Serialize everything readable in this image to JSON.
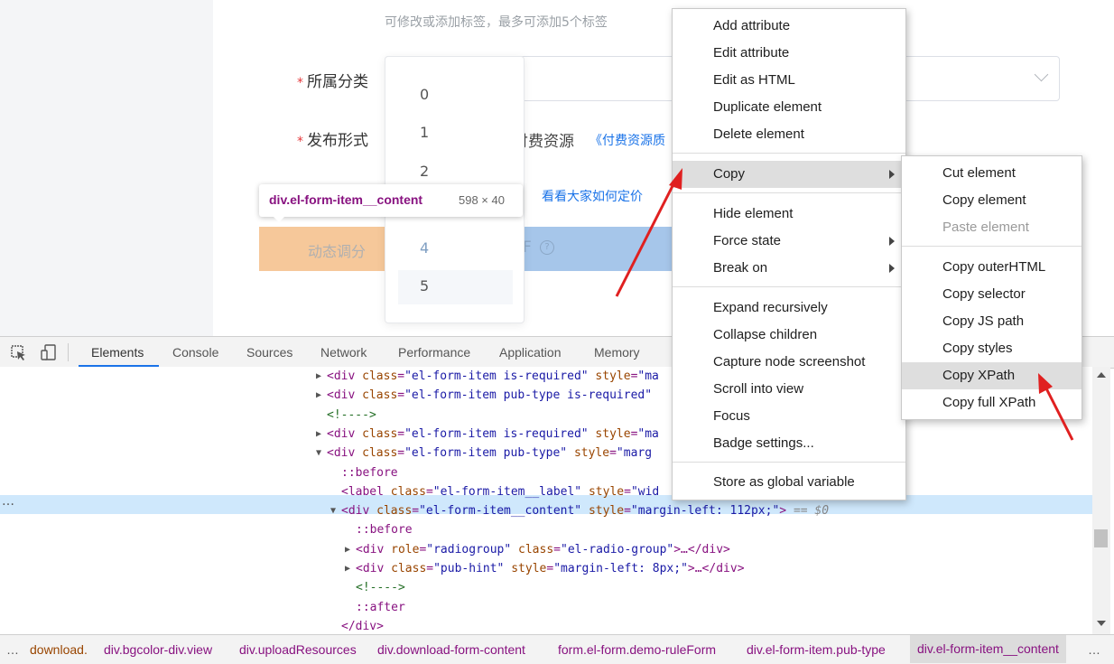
{
  "page": {
    "tag_hint": "可修改或添加标签，最多可添加5个标签",
    "category_label": "所属分类",
    "publish_label": "发布形式",
    "publish_value_partial": "付费资源",
    "paid_quality_link": "《付费资源质",
    "price_link": "看看大家如何定价",
    "dynamic_label": "动态调分",
    "dynamic_suffix": "F",
    "required_mark": "*",
    "dropdown_options": [
      "0",
      "1",
      "2",
      "4",
      "5"
    ],
    "tooltip": {
      "selector": "div.el-form-item__content",
      "size": "598 × 40"
    }
  },
  "devtools": {
    "tabs": [
      "Elements",
      "Console",
      "Sources",
      "Network",
      "Performance",
      "Application",
      "Memory"
    ],
    "code_lines": [
      {
        "indent": 350,
        "arrow": "▶",
        "parts": [
          [
            "tag",
            "<div "
          ],
          [
            "attr",
            "class"
          ],
          [
            "tag",
            "="
          ],
          [
            "val",
            "\"el-form-item is-required\""
          ],
          [
            "attr",
            " style"
          ],
          [
            "tag",
            "="
          ],
          [
            "val",
            "\"ma"
          ]
        ]
      },
      {
        "indent": 350,
        "arrow": "▶",
        "parts": [
          [
            "tag",
            "<div "
          ],
          [
            "attr",
            "class"
          ],
          [
            "tag",
            "="
          ],
          [
            "val",
            "\"el-form-item pub-type is-required\""
          ]
        ]
      },
      {
        "indent": 362,
        "arrow": "",
        "parts": [
          [
            "cmt",
            "<!---->"
          ]
        ]
      },
      {
        "indent": 350,
        "arrow": "▶",
        "parts": [
          [
            "tag",
            "<div "
          ],
          [
            "attr",
            "class"
          ],
          [
            "tag",
            "="
          ],
          [
            "val",
            "\"el-form-item is-required\""
          ],
          [
            "attr",
            " style"
          ],
          [
            "tag",
            "="
          ],
          [
            "val",
            "\"ma"
          ]
        ]
      },
      {
        "indent": 350,
        "arrow": "▼",
        "parts": [
          [
            "tag",
            "<div "
          ],
          [
            "attr",
            "class"
          ],
          [
            "tag",
            "="
          ],
          [
            "val",
            "\"el-form-item pub-type\""
          ],
          [
            "attr",
            " style"
          ],
          [
            "tag",
            "="
          ],
          [
            "val",
            "\"marg"
          ]
        ]
      },
      {
        "indent": 378,
        "arrow": "",
        "parts": [
          [
            "pseudo",
            "::before"
          ]
        ]
      },
      {
        "indent": 378,
        "arrow": "",
        "parts": [
          [
            "tag",
            "<label "
          ],
          [
            "attr",
            "class"
          ],
          [
            "tag",
            "="
          ],
          [
            "val",
            "\"el-form-item__label\""
          ],
          [
            "attr",
            " style"
          ],
          [
            "tag",
            "="
          ],
          [
            "val",
            "\"wid"
          ]
        ]
      },
      {
        "indent": 366,
        "arrow": "▼",
        "parts": [
          [
            "tag",
            "<div "
          ],
          [
            "attr",
            "class"
          ],
          [
            "tag",
            "="
          ],
          [
            "val",
            "\"el-form-item__content\""
          ],
          [
            "attr",
            " style"
          ],
          [
            "tag",
            "="
          ],
          [
            "val",
            "\"margin-left: 112px;\""
          ],
          [
            "tag",
            ">"
          ],
          [
            "ghost",
            " == $0"
          ]
        ]
      },
      {
        "indent": 394,
        "arrow": "",
        "parts": [
          [
            "pseudo",
            "::before"
          ]
        ]
      },
      {
        "indent": 382,
        "arrow": "▶",
        "parts": [
          [
            "tag",
            "<div "
          ],
          [
            "attr",
            "role"
          ],
          [
            "tag",
            "="
          ],
          [
            "val",
            "\"radiogroup\""
          ],
          [
            "attr",
            " class"
          ],
          [
            "tag",
            "="
          ],
          [
            "val",
            "\"el-radio-group\""
          ],
          [
            "tag",
            ">…</div>"
          ]
        ]
      },
      {
        "indent": 382,
        "arrow": "▶",
        "parts": [
          [
            "tag",
            "<div "
          ],
          [
            "attr",
            "class"
          ],
          [
            "tag",
            "="
          ],
          [
            "val",
            "\"pub-hint\""
          ],
          [
            "attr",
            " style"
          ],
          [
            "tag",
            "="
          ],
          [
            "val",
            "\"margin-left: 8px;\""
          ],
          [
            "tag",
            ">…</div>"
          ]
        ]
      },
      {
        "indent": 394,
        "arrow": "",
        "parts": [
          [
            "cmt",
            "<!---->"
          ]
        ]
      },
      {
        "indent": 394,
        "arrow": "",
        "parts": [
          [
            "pseudo",
            "::after"
          ]
        ]
      },
      {
        "indent": 378,
        "arrow": "",
        "parts": [
          [
            "tag",
            "</div>"
          ]
        ]
      }
    ],
    "breadcrumbs": [
      "download.",
      "div.bgcolor-div.view",
      "div.uploadResources",
      "div.download-form-content",
      "form.el-form.demo-ruleForm",
      "div.el-form-item.pub-type",
      "div.el-form-item__content"
    ],
    "ellipsis": "…"
  },
  "context_menu": {
    "items": [
      "Add attribute",
      "Edit attribute",
      "Edit as HTML",
      "Duplicate element",
      "Delete element",
      "Copy",
      "Hide element",
      "Force state",
      "Break on",
      "Expand recursively",
      "Collapse children",
      "Capture node screenshot",
      "Scroll into view",
      "Focus",
      "Badge settings...",
      "Store as global variable"
    ]
  },
  "copy_submenu": {
    "items": [
      "Cut element",
      "Copy element",
      "Paste element",
      "Copy outerHTML",
      "Copy selector",
      "Copy JS path",
      "Copy styles",
      "Copy XPath",
      "Copy full XPath"
    ]
  }
}
